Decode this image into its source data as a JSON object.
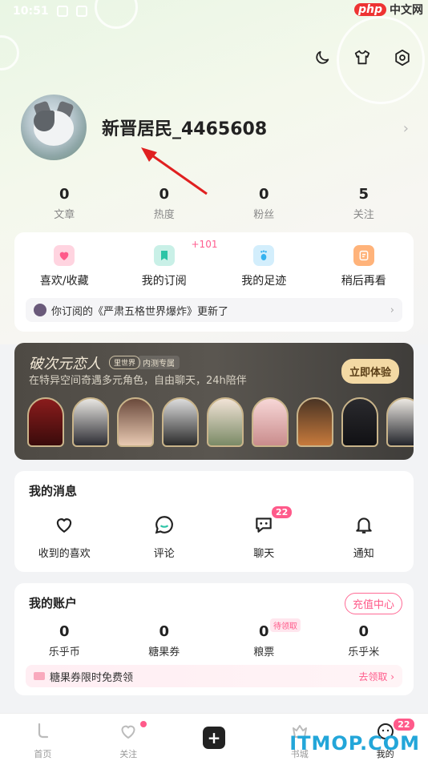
{
  "status_bar": {
    "time": "10:51"
  },
  "watermark_top": {
    "brand": "php",
    "text": "中文网"
  },
  "profile": {
    "username": "新晋居民_4465608"
  },
  "stats": [
    {
      "value": "0",
      "label": "文章"
    },
    {
      "value": "0",
      "label": "热度"
    },
    {
      "value": "0",
      "label": "粉丝"
    },
    {
      "value": "5",
      "label": "关注"
    }
  ],
  "quick": {
    "items": [
      {
        "label": "喜欢/收藏",
        "icon": "heart-bookmark-icon"
      },
      {
        "label": "我的订阅",
        "icon": "bookmark-icon",
        "badge": "+101"
      },
      {
        "label": "我的足迹",
        "icon": "footprint-icon"
      },
      {
        "label": "稍后再看",
        "icon": "watch-later-icon"
      }
    ],
    "notice": "你订阅的《严肃五格世界爆炸》更新了"
  },
  "promo": {
    "title": "破次元恋人",
    "tag1": "里世界",
    "tag2": "内测专属",
    "subtitle": "在特异空间奇遇多元角色，自由聊天，24h陪伴",
    "button": "立即体验"
  },
  "messages": {
    "title": "我的消息",
    "items": [
      {
        "label": "收到的喜欢",
        "icon": "heart-outline-icon"
      },
      {
        "label": "评论",
        "icon": "comment-icon"
      },
      {
        "label": "聊天",
        "icon": "chat-icon",
        "badge": "22"
      },
      {
        "label": "通知",
        "icon": "bell-icon"
      }
    ]
  },
  "account": {
    "title": "我的账户",
    "recharge": "充值中心",
    "items": [
      {
        "value": "0",
        "label": "乐乎币"
      },
      {
        "value": "0",
        "label": "糖果券"
      },
      {
        "value": "0",
        "label": "粮票",
        "tag": "待领取"
      },
      {
        "value": "0",
        "label": "乐乎米"
      }
    ],
    "coupon_text": "糖果券限时免费领",
    "coupon_action": "去领取"
  },
  "tabbar": {
    "items": [
      {
        "label": "首页"
      },
      {
        "label": "关注"
      },
      {
        "label": ""
      },
      {
        "label": "书城"
      },
      {
        "label": "我的",
        "badge": "22"
      }
    ]
  },
  "watermark_bottom": "ITMOP.COM",
  "colors": {
    "accent": "#ff5a8a",
    "promo_button": "#f3d9a4"
  }
}
